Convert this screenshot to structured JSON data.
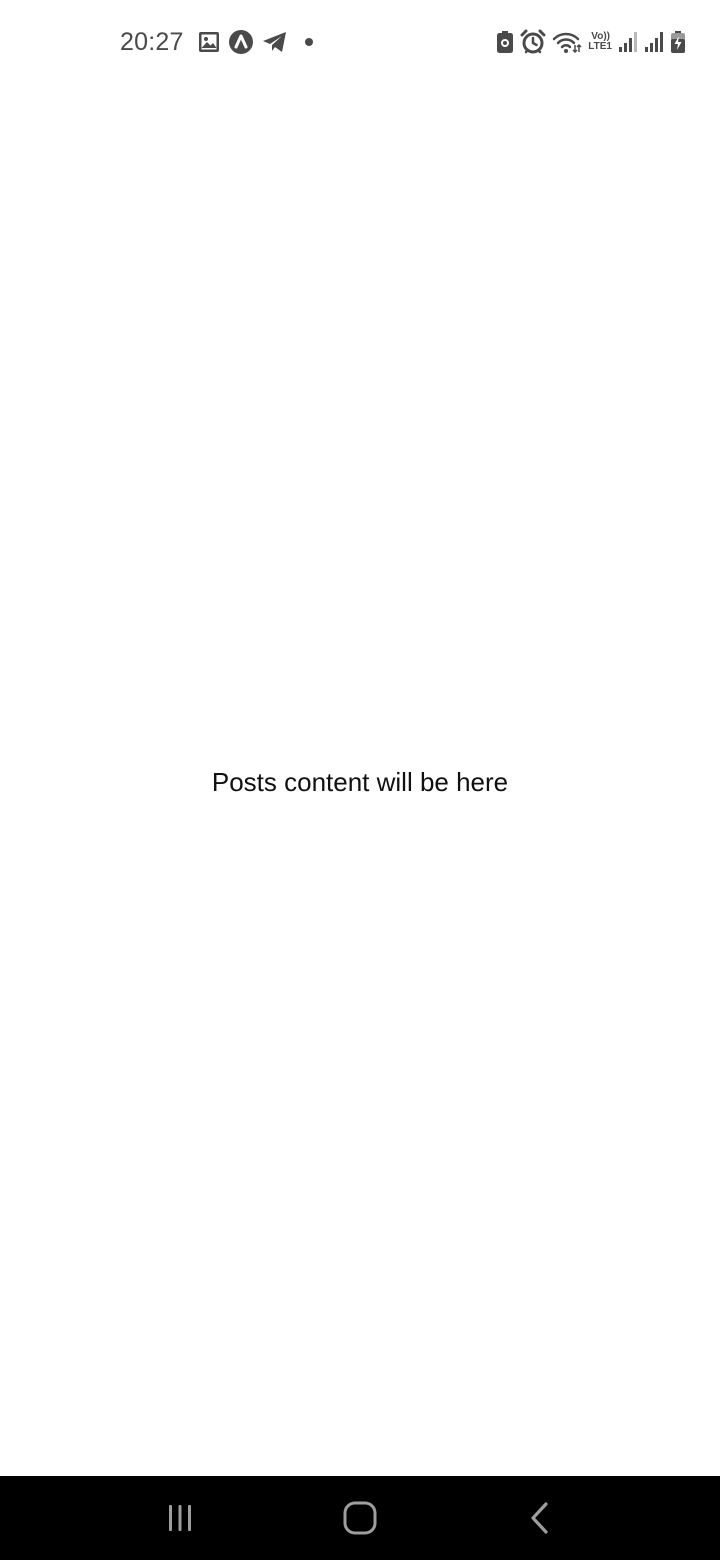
{
  "status_bar": {
    "time": "20:27",
    "left_icons": [
      "gallery-icon",
      "app-notification-icon",
      "telegram-icon",
      "more-notifications-dot-icon"
    ],
    "right_icons": [
      "battery-saver-icon",
      "alarm-icon",
      "wifi-icon",
      "volte-indicator",
      "signal-sim1-icon",
      "signal-sim2-icon",
      "battery-charging-icon"
    ],
    "volte_top": "Vo))",
    "volte_bottom": "LTE1"
  },
  "main": {
    "placeholder": "Posts content will be here"
  },
  "nav_bar": {
    "buttons": [
      "recent-apps-button",
      "home-button",
      "back-button"
    ]
  },
  "colors": {
    "background": "#ffffff",
    "status_icon": "#4a4a4a",
    "text": "#111111",
    "nav_background": "#000000",
    "nav_icon": "#9e9e9e"
  }
}
